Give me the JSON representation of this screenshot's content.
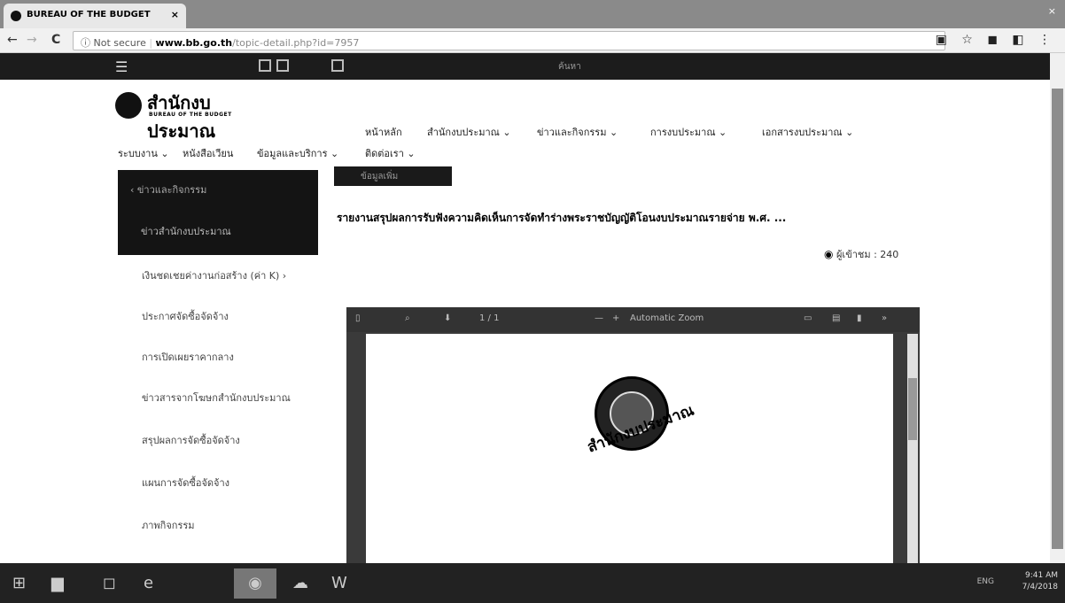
{
  "browser": {
    "tab_title": "BUREAU OF THE BUDGET",
    "tab_close": "×",
    "window_close": "×",
    "nav": {
      "back": "←",
      "forward": "→",
      "reload": "C"
    },
    "security_label": "ⓘ Not secure",
    "url_host": "www.bb.go.th",
    "url_path": "/topic-detail.php?id=7957",
    "extensions": "▣ ☆ ◼ ◧ ⋮"
  },
  "site": {
    "topbar": {
      "menu_icon": "☰",
      "search": "ค้นหา"
    },
    "logo_name": "สำนักงบประมาณ",
    "logo_sub": "BUREAU OF THE BUDGET",
    "main_nav": [
      "หน้าหลัก",
      "สำนักงบประมาณ ⌄",
      "ข่าวและกิจกรรม ⌄",
      "การงบประมาณ ⌄",
      "เอกสารงบประมาณ ⌄"
    ],
    "sub_nav": [
      "ระบบงาน ⌄",
      "หนังสือเวียน",
      "ข้อมูลและบริการ ⌄",
      "ติดต่อเรา ⌄"
    ]
  },
  "sidebar": {
    "back_label": "‹  ข่าวและกิจกรรม",
    "active_item": "ข่าวสำนักงบประมาณ",
    "items": [
      "เงินชดเชยค่างานก่อสร้าง (ค่า K) ›",
      "ประกาศจัดซื้อจัดจ้าง",
      "การเปิดเผยราคากลาง",
      "ข่าวสารจากโฆษกสำนักงบประมาณ",
      "สรุปผลการจัดซื้อจัดจ้าง",
      "แผนการจัดซื้อจัดจ้าง",
      "ภาพกิจกรรม"
    ]
  },
  "article": {
    "category": "ข้อมูลเพิ่ม",
    "title": "รายงานสรุปผลการรับฟังความคิดเห็นการจัดทำร่างพระราชบัญญัติโอนงบประมาณรายจ่าย พ.ศ. ...",
    "viewers_label": "ผู้เข้าชม : 240",
    "eye_icon": "◉"
  },
  "pdf_viewer": {
    "page_info": "1 / 1",
    "zoom": "Automatic Zoom",
    "seal_text": "สำนักงบประมาณ"
  },
  "taskbar": {
    "tray": "ENG",
    "time": "9:41 AM",
    "date": "7/4/2018"
  }
}
